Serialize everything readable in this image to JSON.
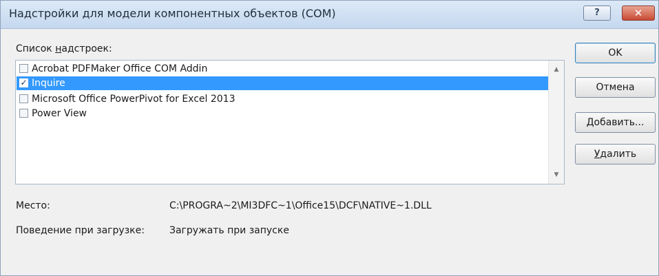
{
  "window": {
    "title": "Надстройки для модели компонентных объектов (COM)",
    "help_label": "?",
    "close_label": "✕"
  },
  "addins": {
    "label_prefix": "Список ",
    "label_accel": "н",
    "label_suffix": "адстроек:",
    "items": [
      {
        "label": "Acrobat PDFMaker Office COM Addin",
        "checked": false,
        "selected": false
      },
      {
        "label": "Inquire",
        "checked": true,
        "selected": true
      },
      {
        "label": "Microsoft Office PowerPivot for Excel 2013",
        "checked": false,
        "selected": false
      },
      {
        "label": "Power View",
        "checked": false,
        "selected": false
      }
    ],
    "check_mark": "✓"
  },
  "scrollbar": {
    "up_arrow": "▲",
    "down_arrow": "▼"
  },
  "buttons": {
    "ok": "OK",
    "cancel": "Отмена",
    "add_accel": "Д",
    "add_rest": "обавить...",
    "remove_accel": "У",
    "remove_rest": "далить"
  },
  "details": {
    "location_label": "Место:",
    "location_value": "C:\\PROGRA~2\\MI3DFC~1\\Office15\\DCF\\NATIVE~1.DLL",
    "behavior_label": "Поведение при загрузке:",
    "behavior_value": "Загружать при запуске"
  },
  "colors": {
    "selection": "#3399ff",
    "close_button": "#c84a34",
    "titlebar": "#c5d8ef"
  }
}
